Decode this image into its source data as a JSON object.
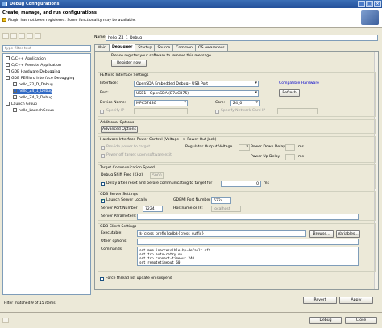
{
  "window": {
    "title": "Debug Configurations",
    "buttons": [
      "_",
      "□",
      "×"
    ]
  },
  "header": {
    "title": "Create, manage, and run configurations",
    "warning": "Plugin has not been registered. Some functionality may be available."
  },
  "left": {
    "filter_placeholder": "type filter text",
    "tree": [
      {
        "label": "C/C++ Application",
        "level": 1
      },
      {
        "label": "C/C++ Remote Application",
        "level": 1
      },
      {
        "label": "GDB Hardware Debugging",
        "level": 1
      },
      {
        "label": "GDB PEMicro Interface Debugging",
        "level": 1
      },
      {
        "label": "hello_Z2_D_Debug",
        "level": 2
      },
      {
        "label": "hello_Z4_1_Debug",
        "level": 2,
        "selected": true
      },
      {
        "label": "hello_Z4_2_Debug",
        "level": 2
      },
      {
        "label": "Launch Group",
        "level": 1
      },
      {
        "label": "hello_LaunchGroup",
        "level": 2
      }
    ],
    "status": "Filter matched 9 of 15 items"
  },
  "name": {
    "label": "Name:",
    "value": "hello_Z4_1_Debug"
  },
  "tabs": [
    "Main",
    "Debugger",
    "Startup",
    "Source",
    "Common",
    "OS Awareness"
  ],
  "active_tab": "Debugger",
  "register": {
    "text": "Please register your software to remove this message.",
    "button": "Register now"
  },
  "pemicro": {
    "group": "PEMicro Interface Settings",
    "interface_label": "Interface:",
    "interface_value": "OpenSDA Embedded Debug - USB Port",
    "compatible_link": "Compatible Hardware",
    "port_label": "Port:",
    "port_value": "USB1 - OpenSDA (B7ACB75)",
    "refresh": "Refresh",
    "device_label": "Device Name:",
    "device_value": "MPC5748G",
    "core_label": "Core:",
    "core_value": "Z4_0",
    "specify_ip": "Specify IP",
    "specify_network": "Specify Network Card IP"
  },
  "additional": {
    "group": "Additional Options",
    "button": "Advanced Options"
  },
  "power": {
    "group": "Hardware Interface Power Control (Voltage --> Power-Out Jack)",
    "provide_power": "Provide power to target",
    "power_off": "Power off target upon software exit",
    "regulator": "Regulator Output Voltage",
    "power_down": "Power Down Delay",
    "power_up": "Power Up Delay",
    "ms": "ms"
  },
  "comm": {
    "group": "Target Communication Speed",
    "shift_label": "Debug Shift Freq (KHz)",
    "shift_value": "5000",
    "delay_label": "Delay after reset and before communicating to target for",
    "delay_value": "0",
    "delay_unit": "ms"
  },
  "gdbserver": {
    "group": "GDB Server Settings",
    "launch_label": "Launch Server Locally",
    "gdbmi_label": "GDBMI Port Number",
    "gdbmi_value": "6224",
    "port_label": "Server Port Number",
    "port_value": "7224",
    "host_label": "Hostname or IP:",
    "host_value": "localhost",
    "params_label": "Server Parameters:"
  },
  "gdbclient": {
    "group": "GDB Client Settings",
    "exe_label": "Executable:",
    "exe_value": "${cross_prefix}gdb${cross_suffix}",
    "browse": "Browse...",
    "variables": "Variables...",
    "other_label": "Other options:",
    "commands_label": "Commands:",
    "commands": [
      "set mem inaccessible-by-default off",
      "set tcp auto-retry on",
      "set tcp connect-timeout 240",
      "set remotetimeout 60"
    ]
  },
  "force_thread": "Force thread list update on suspend",
  "panel_buttons": {
    "revert": "Revert",
    "apply": "Apply"
  },
  "bottom": {
    "debug": "Debug",
    "close": "Close"
  }
}
